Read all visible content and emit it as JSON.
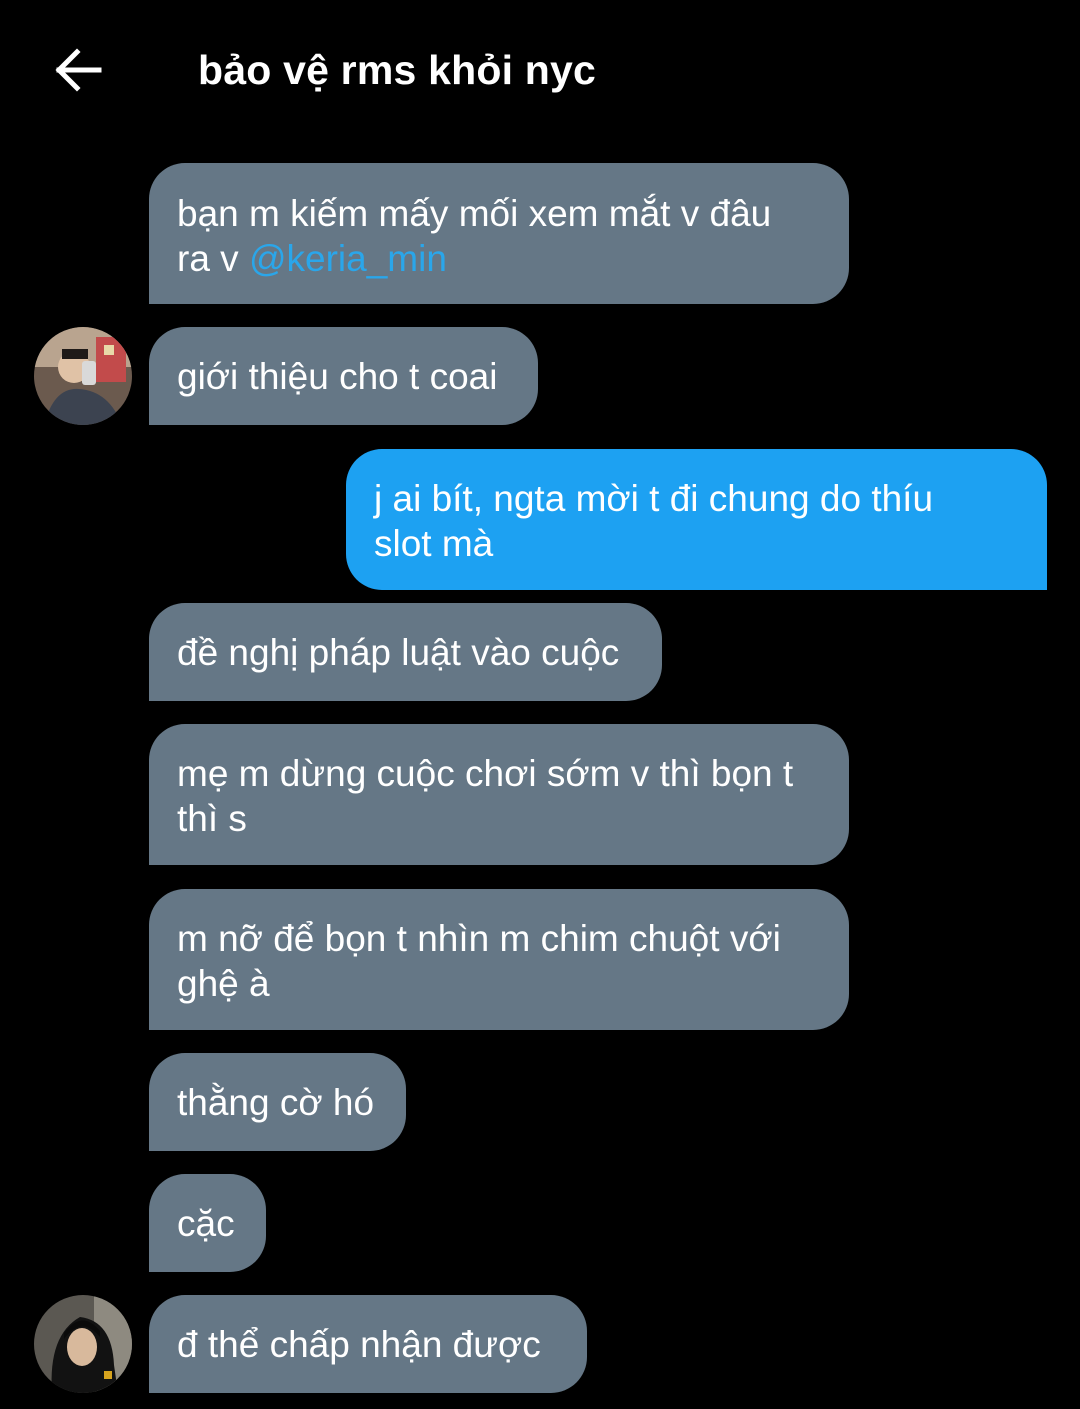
{
  "header": {
    "title": "bảo vệ rms khỏi nyc",
    "back_icon": "arrow-left-icon"
  },
  "messages": [
    {
      "direction": "in",
      "text": "bạn m kiếm mấy mối xem mắt v đâu\nra v ",
      "mention": "@keria_min"
    },
    {
      "direction": "in",
      "text": "giới thiệu cho t coai",
      "avatar": "user-avatar-1"
    },
    {
      "direction": "out",
      "text": "j ai bít, ngta mời t đi chung do thíu\nslot mà"
    },
    {
      "direction": "in",
      "text": "đề nghị pháp luật vào cuộc"
    },
    {
      "direction": "in",
      "text": "mẹ m dừng cuộc chơi sớm v thì bọn t\nthì s"
    },
    {
      "direction": "in",
      "text": "m nỡ để bọn t nhìn m chim chuột với\nghệ à"
    },
    {
      "direction": "in",
      "text": "thằng cờ hó"
    },
    {
      "direction": "in",
      "text": "cặc"
    },
    {
      "direction": "in",
      "text": "đ thể chấp nhận được",
      "avatar": "user-avatar-2"
    }
  ],
  "colors": {
    "background": "#000000",
    "incoming_bubble": "#657786",
    "outgoing_bubble": "#1da1f2",
    "mention": "#2aa6ea",
    "text": "#ffffff"
  }
}
